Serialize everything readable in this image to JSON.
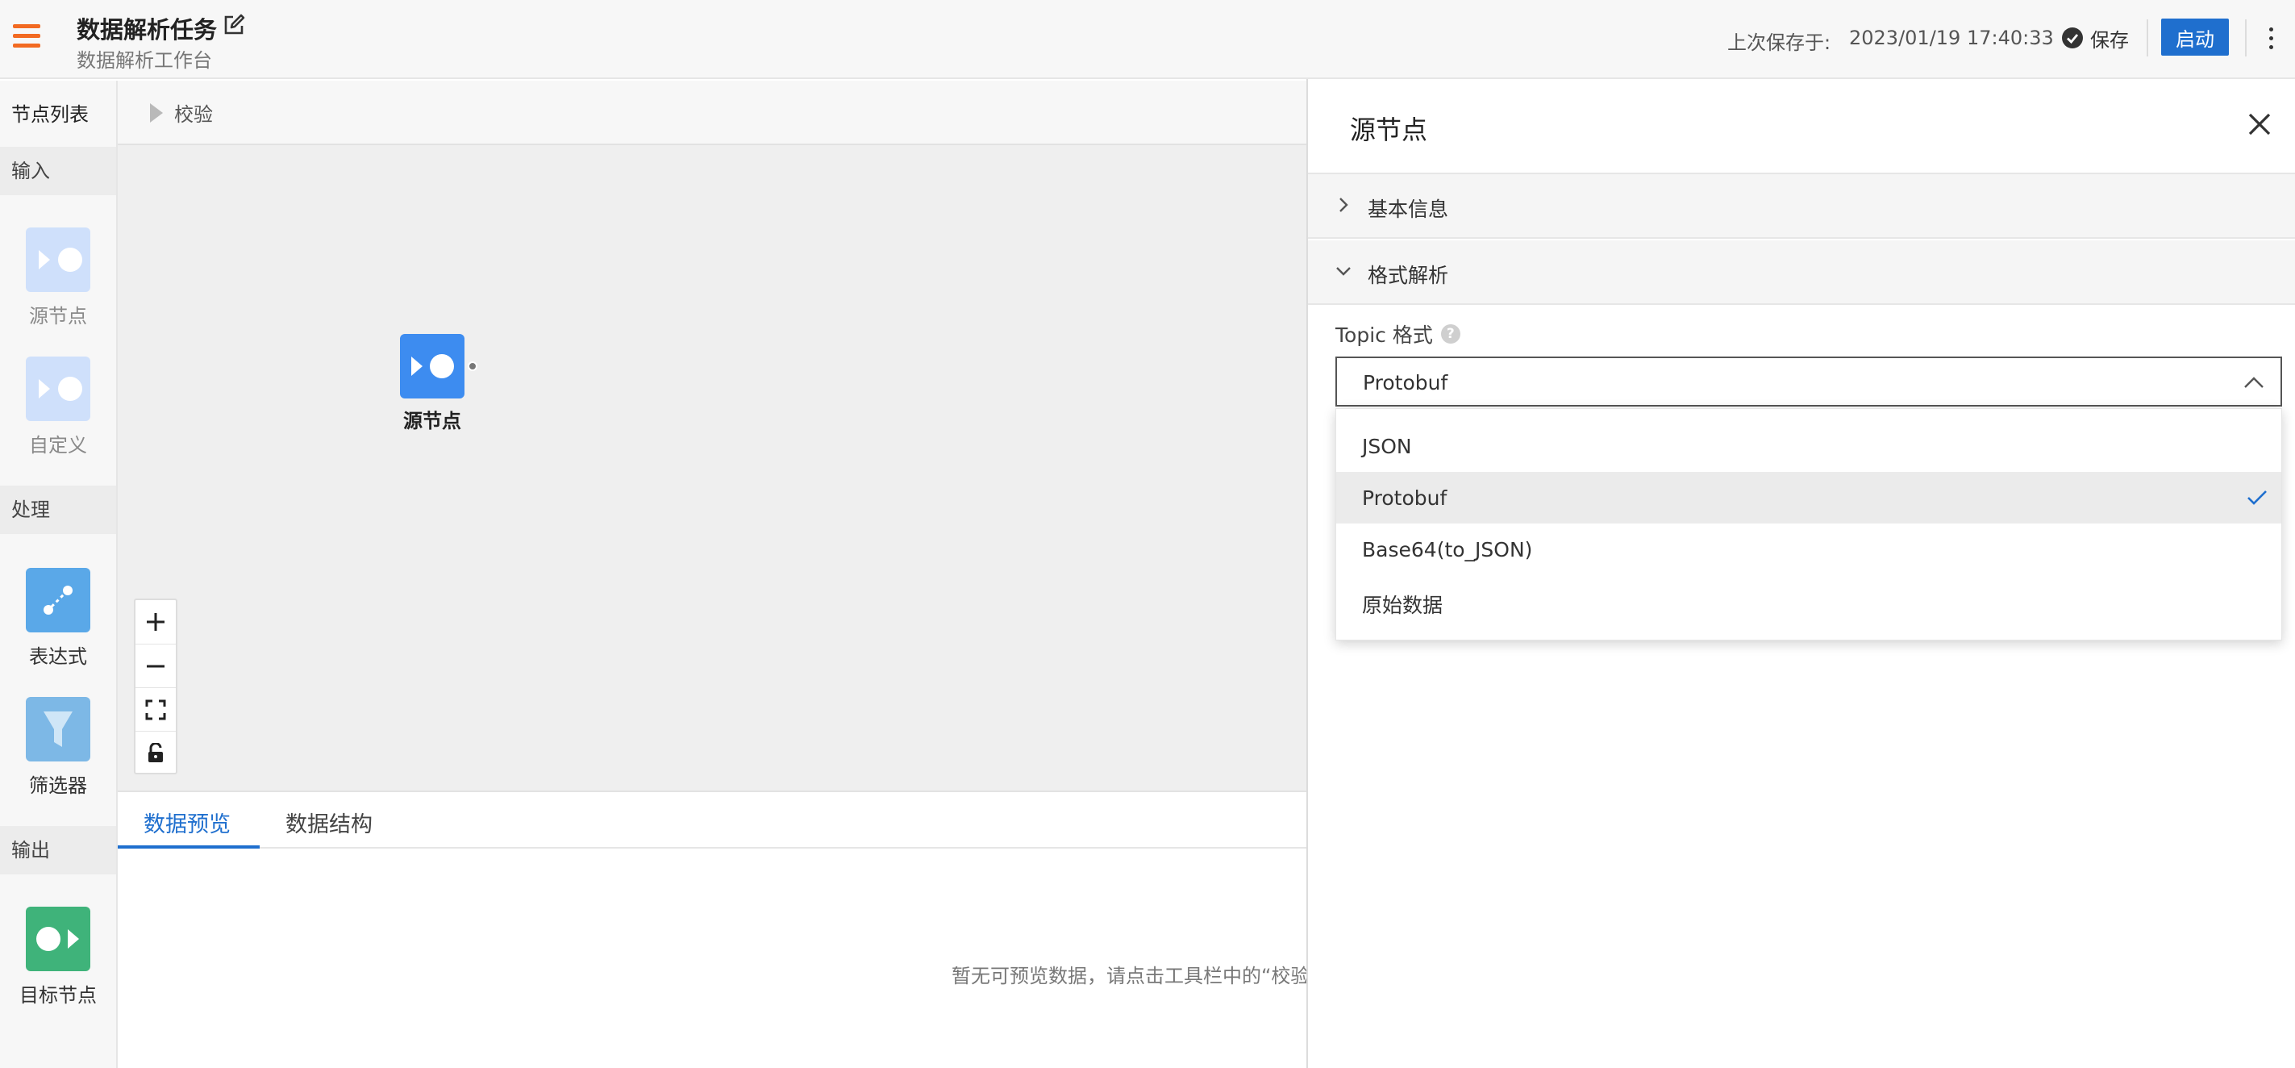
{
  "header": {
    "title": "数据解析任务",
    "subtitle": "数据解析工作台",
    "last_saved_label": "上次保存于:",
    "last_saved_time": "2023/01/19 17:40:33",
    "save_label": "保存",
    "start_label": "启动",
    "icons": [
      "menu-icon",
      "edit-icon",
      "check-circle-icon",
      "more-vertical-icon"
    ],
    "accent_color": "#f26a22",
    "primary_color": "#1f6fce"
  },
  "node_panel": {
    "title": "节点列表",
    "sections": [
      {
        "label": "输入",
        "items": [
          {
            "label": "源节点"
          },
          {
            "label": "自定义"
          }
        ]
      },
      {
        "label": "处理",
        "items": [
          {
            "label": "表达式"
          },
          {
            "label": "筛选器"
          }
        ]
      },
      {
        "label": "输出",
        "items": [
          {
            "label": "目标节点"
          }
        ]
      }
    ]
  },
  "toolbar": {
    "verify_label": "校验"
  },
  "canvas": {
    "node_label": "源节点",
    "zoom_controls": [
      "zoom-in-icon",
      "zoom-out-icon",
      "fit-screen-icon",
      "lock-icon"
    ]
  },
  "preview": {
    "tabs": [
      {
        "label": "数据预览",
        "active": true
      },
      {
        "label": "数据结构",
        "active": false
      }
    ],
    "empty_message": "暂无可预览数据，请点击工具栏中的“校验”"
  },
  "drawer": {
    "title": "源节点",
    "sections": [
      {
        "label": "基本信息",
        "expanded": false
      },
      {
        "label": "格式解析",
        "expanded": true
      }
    ],
    "topic_format": {
      "label": "Topic 格式",
      "help_icon": "?",
      "value": "Protobuf",
      "options": [
        {
          "label": "JSON",
          "selected": false
        },
        {
          "label": "Protobuf",
          "selected": true
        },
        {
          "label": "Base64(to_JSON)",
          "selected": false
        },
        {
          "label": "原始数据",
          "selected": false
        }
      ]
    }
  }
}
